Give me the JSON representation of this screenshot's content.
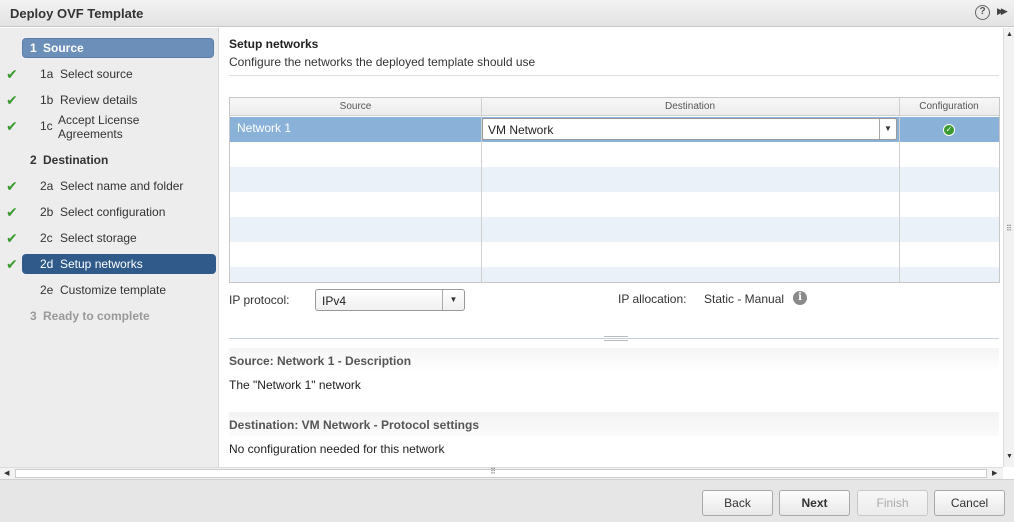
{
  "window": {
    "title": "Deploy OVF Template",
    "help_icon": "help-icon",
    "expand_icon": "expand-icon"
  },
  "wizard_steps": [
    {
      "num": "1",
      "label": "Source",
      "kind": "group",
      "state": "selected-light",
      "check": false
    },
    {
      "num": "1a",
      "label": "Select source",
      "kind": "sub",
      "state": "done",
      "check": true
    },
    {
      "num": "1b",
      "label": "Review details",
      "kind": "sub",
      "state": "done",
      "check": true
    },
    {
      "num": "1c",
      "label": "Accept License Agreements",
      "kind": "sub",
      "state": "done",
      "check": true
    },
    {
      "num": "2",
      "label": "Destination",
      "kind": "group",
      "state": "normal",
      "check": false
    },
    {
      "num": "2a",
      "label": "Select name and folder",
      "kind": "sub",
      "state": "done",
      "check": true
    },
    {
      "num": "2b",
      "label": "Select configuration",
      "kind": "sub",
      "state": "done",
      "check": true
    },
    {
      "num": "2c",
      "label": "Select storage",
      "kind": "sub",
      "state": "done",
      "check": true
    },
    {
      "num": "2d",
      "label": "Setup networks",
      "kind": "sub",
      "state": "current",
      "check": true
    },
    {
      "num": "2e",
      "label": "Customize template",
      "kind": "sub",
      "state": "normal",
      "check": false
    },
    {
      "num": "3",
      "label": "Ready to complete",
      "kind": "group",
      "state": "disabled",
      "check": false
    }
  ],
  "main": {
    "title": "Setup networks",
    "subtitle": "Configure the networks the deployed template should use",
    "grid": {
      "columns": [
        "Source",
        "Destination",
        "Configuration"
      ],
      "rows": [
        {
          "source": "Network 1",
          "destination": "VM Network",
          "configuration_icon": "ok-check-icon"
        }
      ]
    },
    "ip_protocol": {
      "label": "IP protocol:",
      "value": "IPv4"
    },
    "ip_allocation": {
      "label": "IP allocation:",
      "value": "Static - Manual",
      "icon": "info-icon"
    },
    "source_desc": {
      "title": "Source: Network 1 - Description",
      "body": "The \"Network 1\" network"
    },
    "dest_settings": {
      "title": "Destination: VM Network - Protocol settings",
      "body": "No configuration needed for this network"
    }
  },
  "footer": {
    "back": "Back",
    "next": "Next",
    "finish": "Finish",
    "cancel": "Cancel"
  },
  "colors": {
    "selected_row": "#8ab2d9",
    "current_step": "#2f5a8a",
    "check_green": "#3a9a2f"
  }
}
